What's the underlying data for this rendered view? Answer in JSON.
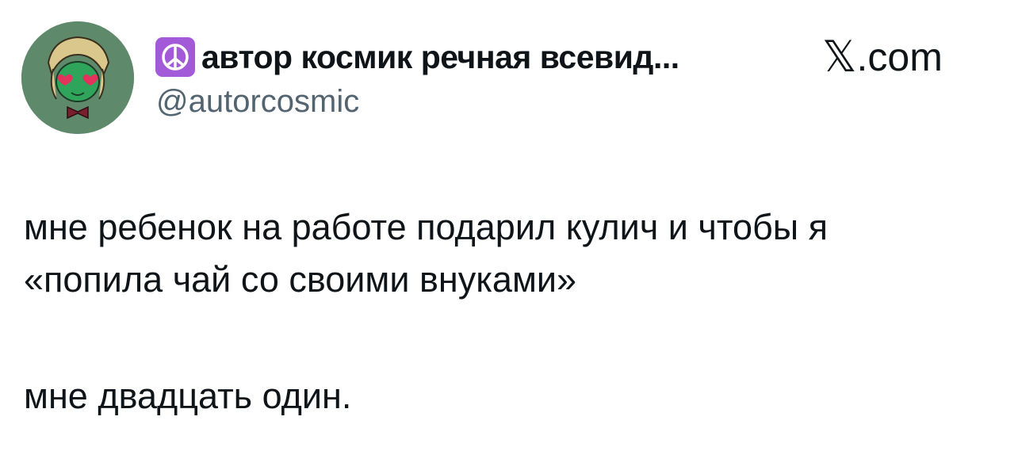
{
  "author": {
    "emoji_icon": "peace-symbol-icon",
    "display_name": "автор космик речная всевид...",
    "username": "@autorcosmic",
    "avatar_icon": "cartoon-avatar-icon"
  },
  "brand": {
    "logo_mark": "𝕏",
    "domain": ".com"
  },
  "tweet": {
    "line_1": "мне ребенок на работе подарил кулич и чтобы я",
    "line_2": "«попила чай со своими внуками»",
    "line_3": "мне двадцать один."
  },
  "colors": {
    "text": "#0f1419",
    "secondary_text": "#536471",
    "avatar_bg": "#5e8a6b",
    "emoji_bg": "#a35ad8"
  }
}
